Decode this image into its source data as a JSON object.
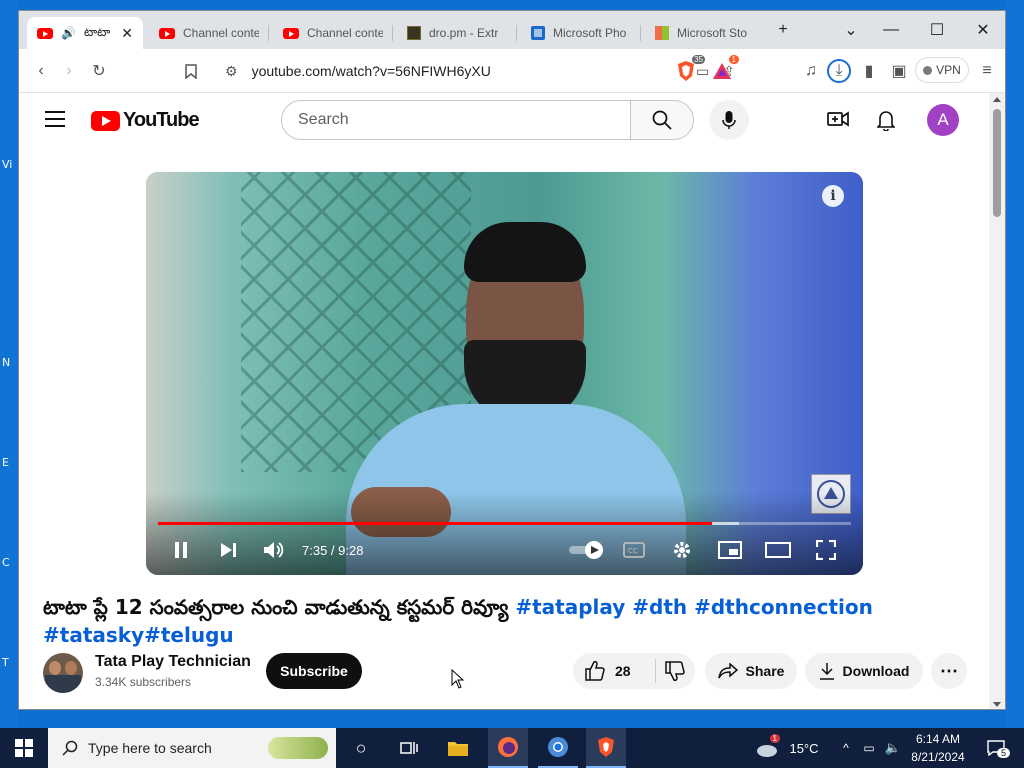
{
  "browser": {
    "tabs": [
      {
        "label": "టాటా",
        "active": true
      },
      {
        "label": "Channel conte"
      },
      {
        "label": "Channel conte"
      },
      {
        "label": "dro.pm - Extr"
      },
      {
        "label": "Microsoft Pho"
      },
      {
        "label": "Microsoft Sto"
      }
    ],
    "url": "youtube.com/watch?v=56NFIWH6yXU",
    "vpn_label": "VPN",
    "brave_badge": "35",
    "rewards_badge": "1"
  },
  "youtube": {
    "logo_text": "YouTube",
    "search_placeholder": "Search",
    "avatar_letter": "A",
    "video": {
      "time": "7:35 / 9:28",
      "progress": 0.799
    },
    "title_text": "టాటా ప్లే 12 సంవత్సరాల నుంచి వాడుతున్న కస్టమర్ రివ్యూ ",
    "hashtags_line1": "#tataplay #dth #dthconnection",
    "hashtags_line2": "#tatasky#telugu",
    "channel_name": "Tata Play Technician",
    "subscribers": "3.34K subscribers",
    "subscribe_label": "Subscribe",
    "likes": "28",
    "share_label": "Share",
    "download_label": "Download"
  },
  "desktop": {
    "side_labels": [
      "Vi",
      "N",
      "E",
      "C",
      "T"
    ]
  },
  "taskbar": {
    "search_placeholder": "Type here to search",
    "weather": "15°C",
    "time": "6:14 AM",
    "date": "8/21/2024",
    "notification_count": "5",
    "weather_badge": "1"
  },
  "colors": {
    "youtube_red": "#ff0000",
    "link_blue": "#065fd4",
    "taskbar_bg": "#0f1f3d",
    "avatar_purple": "#a142c4"
  }
}
